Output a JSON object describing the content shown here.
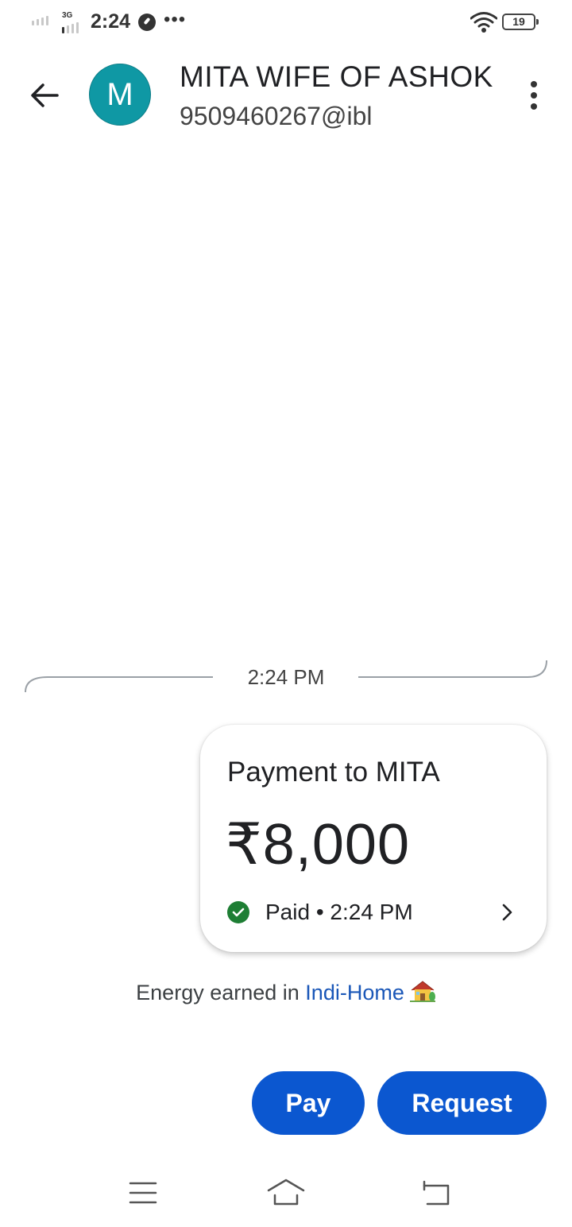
{
  "status_bar": {
    "network_tag": "3G",
    "time": "2:24",
    "more": "•••",
    "battery_level": "19"
  },
  "header": {
    "avatar_letter": "M",
    "contact_name": "MITA WIFE OF ASHOK",
    "upi_id": "9509460267@ibl"
  },
  "conversation": {
    "divider_time": "2:24 PM",
    "payment": {
      "title": "Payment to MITA",
      "amount": "₹8,000",
      "status": "Paid • 2:24 PM"
    },
    "energy_prefix": "Energy earned in ",
    "energy_link": "Indi-Home"
  },
  "actions": {
    "pay_label": "Pay",
    "request_label": "Request"
  },
  "colors": {
    "primary": "#0b57d0",
    "avatar": "#0f98a4",
    "success": "#1e7e34",
    "link": "#1a57b8"
  }
}
